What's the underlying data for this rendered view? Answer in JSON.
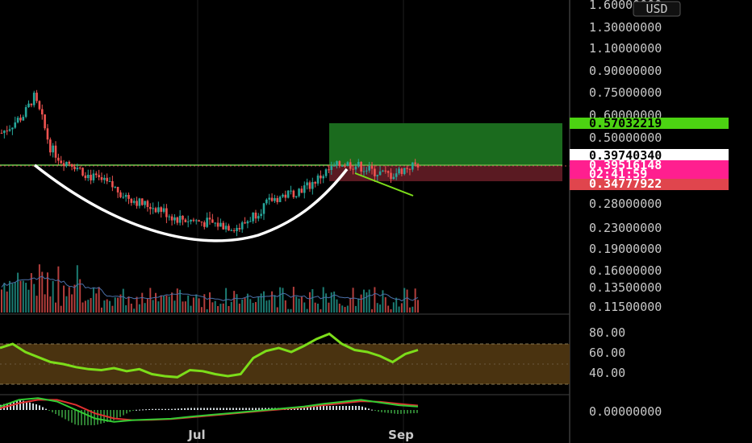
{
  "currency": "USD",
  "price_axis": [
    "1.60000000",
    "1.30000000",
    "1.10000000",
    "0.90000000",
    "0.75000000",
    "0.60000000",
    "0.50000000",
    "0.28000000",
    "0.23000000",
    "0.19000000",
    "0.16000000",
    "0.13500000",
    "0.11500000"
  ],
  "tags": {
    "target": "0.57032219",
    "last": "0.39740340",
    "current": "0.39516148",
    "countdown": "02:41:59",
    "stop": "0.34777922"
  },
  "rsi_axis": [
    "80.00",
    "60.00",
    "40.00"
  ],
  "macd_axis": [
    "0.00000000"
  ],
  "time_axis": [
    "Jul",
    "Sep"
  ],
  "colors": {
    "up": "#26a69a",
    "down": "#ef5350",
    "target_zone": "#1b6b1e",
    "stop_zone": "#5a1a22",
    "rsi": "#7cdd1a",
    "rsi_band": "#4a3310",
    "macd": "#33cc33",
    "signal": "#e03030"
  },
  "chart_data": {
    "type": "candlestick",
    "scale": "log",
    "ylim": [
      0.115,
      1.6
    ],
    "x": [
      "Jul",
      "Sep"
    ],
    "candle_count": 155,
    "price_path": [
      [
        0,
        0.52
      ],
      [
        8,
        0.6
      ],
      [
        12,
        0.72
      ],
      [
        15,
        0.58
      ],
      [
        18,
        0.46
      ],
      [
        22,
        0.41
      ],
      [
        26,
        0.4
      ],
      [
        32,
        0.36
      ],
      [
        40,
        0.33
      ],
      [
        46,
        0.3
      ],
      [
        52,
        0.28
      ],
      [
        58,
        0.27
      ],
      [
        64,
        0.25
      ],
      [
        70,
        0.245
      ],
      [
        76,
        0.24
      ],
      [
        82,
        0.235
      ],
      [
        88,
        0.23
      ],
      [
        94,
        0.26
      ],
      [
        100,
        0.29
      ],
      [
        108,
        0.31
      ],
      [
        114,
        0.33
      ],
      [
        120,
        0.37
      ],
      [
        126,
        0.4
      ],
      [
        132,
        0.39
      ],
      [
        138,
        0.37
      ],
      [
        144,
        0.36
      ],
      [
        150,
        0.385
      ],
      [
        154,
        0.397
      ]
    ],
    "trade_setup": {
      "entry": 0.3974034,
      "target": 0.57032219,
      "stop": 0.34777922,
      "current": 0.39516148
    },
    "rsi": {
      "ylim": [
        25,
        95
      ],
      "band": [
        30,
        70
      ],
      "values": [
        66,
        70,
        62,
        57,
        52,
        50,
        47,
        45,
        44,
        46,
        43,
        45,
        40,
        38,
        37,
        44,
        43,
        40,
        38,
        40,
        56,
        63,
        66,
        62,
        68,
        75,
        80,
        70,
        64,
        62,
        58,
        52,
        60,
        64
      ]
    },
    "macd": {
      "macd": [
        0.01,
        0.03,
        0.035,
        0.025,
        0.0,
        -0.025,
        -0.035,
        -0.03,
        -0.028,
        -0.026,
        -0.02,
        -0.015,
        -0.01,
        -0.005,
        0.0,
        0.005,
        0.01,
        0.018,
        0.024,
        0.03,
        0.022,
        0.014,
        0.01
      ],
      "signal": [
        0.005,
        0.02,
        0.03,
        0.03,
        0.015,
        -0.01,
        -0.025,
        -0.03,
        -0.029,
        -0.027,
        -0.022,
        -0.017,
        -0.012,
        -0.007,
        -0.002,
        0.003,
        0.008,
        0.014,
        0.02,
        0.026,
        0.024,
        0.018,
        0.013
      ]
    }
  }
}
